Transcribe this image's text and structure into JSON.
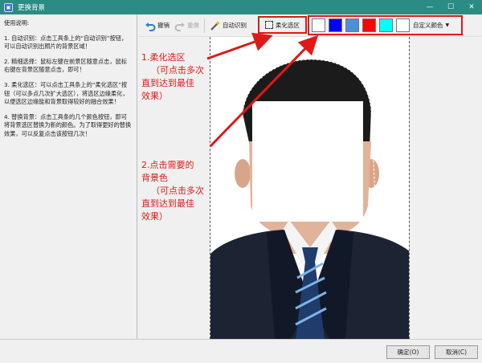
{
  "window": {
    "title": "更换背景",
    "controls": [
      "—",
      "☐",
      "✕"
    ]
  },
  "help": {
    "title": "使用说明:",
    "paragraphs": [
      "1. 自动识别：点击工具条上的“自动识别”按钮，可以自动识别出照片的背景区域！",
      "2. 精细选择：鼠标左键在前景区随意点击，鼠标右键在背景区随意点击，即可！",
      "3. 柔化选区：可以点击工具条上的“柔化选区”按钮（可以多点几次扩大选区），将选区边缘柔化，以便选区边缘能和背景取得较好的融合效果！",
      "4. 替换背景：点击工具条的几个颜色按钮，即可将背景选区替换为新的颜色。为了取得更好的替换效果，可以反复点击该按钮几次！"
    ]
  },
  "toolbar": {
    "undo_label": "撤销",
    "redo_label": "重做",
    "auto_label": "自动识别",
    "soft_label": "柔化选区",
    "custom_color_label": "自定义颜色",
    "swatches": [
      "#ffffff",
      "#0000ff",
      "#4a90d9",
      "#ff0000",
      "#00ffff",
      "#ffffff"
    ]
  },
  "annotations": {
    "a1": [
      "1.柔化选区",
      "（可点击多次",
      "直到达到最佳",
      "效果）"
    ],
    "a2": [
      "2.点击需要的",
      "背景色",
      "（可点击多次",
      "直到达到最佳",
      "效果）"
    ]
  },
  "buttons": {
    "ok_label": "确定(O)",
    "cancel_label": "取消(C)"
  }
}
